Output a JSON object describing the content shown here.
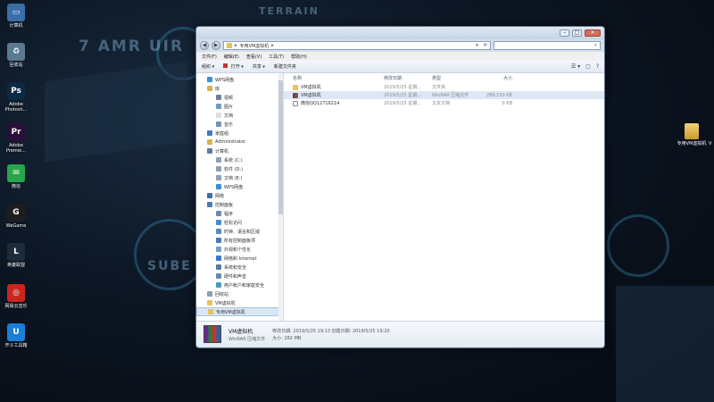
{
  "desktop": {
    "icons": [
      {
        "label": "计算机",
        "icon": "computer-icon",
        "color": "#3a6ea8",
        "glyph": "▭"
      },
      {
        "label": "回收站",
        "icon": "recycle-bin-icon",
        "color": "#5a7a90",
        "glyph": "♻"
      },
      {
        "label": "Adobe Photosh...",
        "icon": "photoshop-icon",
        "color": "#0b2a44",
        "glyph": "Ps"
      },
      {
        "label": "Adobe Premie...",
        "icon": "premiere-icon",
        "color": "#2a0f3a",
        "glyph": "Pr"
      },
      {
        "label": "微信",
        "icon": "wechat-icon",
        "color": "#2aa44a",
        "glyph": "✉"
      },
      {
        "label": "WeGame",
        "icon": "wegame-icon",
        "color": "#1e1e1e",
        "glyph": "G"
      },
      {
        "label": "英雄联盟",
        "icon": "lol-icon",
        "color": "#1d2c3a",
        "glyph": "L"
      },
      {
        "label": "网易云音乐",
        "icon": "netease-music-icon",
        "color": "#c8261e",
        "glyph": "◎"
      },
      {
        "label": "开斗工具箱",
        "icon": "toolbox-icon",
        "color": "#1b7fd6",
        "glyph": "U"
      }
    ],
    "right_icon": {
      "label": "专用VM虚拟机",
      "icon": "folder-icon"
    },
    "right_icon_extra": "V"
  },
  "window": {
    "address": {
      "path_sep": "▸",
      "path": "专用VM虚拟机",
      "arrow": "▸",
      "dropdown": "▾",
      "refresh": "⟳",
      "search_icon": "⌕"
    },
    "title_buttons": {
      "minimize": "–",
      "maximize": "□",
      "close": "✕"
    },
    "nav_back": "◀",
    "nav_forward": "▶",
    "menu": [
      "文件(F)",
      "编辑(E)",
      "查看(V)",
      "工具(T)",
      "帮助(H)"
    ],
    "toolbar": {
      "organize": "组织 ▾",
      "open": "打开 ▾",
      "share": "共享 ▾",
      "new_folder": "新建文件夹",
      "icons": [
        "☰ ▾",
        "▢",
        "?"
      ]
    },
    "nav_pane": [
      {
        "label": "WPS网盘",
        "indent": 1,
        "color": "#3a8fd8"
      },
      {
        "label": "库",
        "indent": 1,
        "color": "#d9b24a"
      },
      {
        "label": "视频",
        "indent": 2,
        "color": "#6a7fa0"
      },
      {
        "label": "图片",
        "indent": 2,
        "color": "#6a9fc0"
      },
      {
        "label": "文档",
        "indent": 2,
        "color": "#e0e0e0"
      },
      {
        "label": "音乐",
        "indent": 2,
        "color": "#7a90c0"
      },
      {
        "label": "家庭组",
        "indent": 1,
        "color": "#3a7ac8"
      },
      {
        "label": "Administrator",
        "indent": 1,
        "color": "#d9b24a"
      },
      {
        "label": "计算机",
        "indent": 1,
        "color": "#5a7a9a"
      },
      {
        "label": "系统 (C:)",
        "indent": 2,
        "color": "#8aa0b8"
      },
      {
        "label": "软件 (D:)",
        "indent": 2,
        "color": "#8aa0b8"
      },
      {
        "label": "文档 (E:)",
        "indent": 2,
        "color": "#8aa0b8"
      },
      {
        "label": "WPS网盘",
        "indent": 2,
        "color": "#3a8fd8"
      },
      {
        "label": "网络",
        "indent": 1,
        "color": "#3a6ea8"
      },
      {
        "label": "控制面板",
        "indent": 1,
        "color": "#4a7ab8"
      },
      {
        "label": "程序",
        "indent": 2,
        "color": "#6a8ab0"
      },
      {
        "label": "轻松访问",
        "indent": 2,
        "color": "#3a8fd8"
      },
      {
        "label": "时钟、语言和区域",
        "indent": 2,
        "color": "#5a8ac0"
      },
      {
        "label": "所有控制面板项",
        "indent": 2,
        "color": "#4a7ab8"
      },
      {
        "label": "外观和个性化",
        "indent": 2,
        "color": "#7a9ac8"
      },
      {
        "label": "网络和 Internet",
        "indent": 2,
        "color": "#3a7ac8"
      },
      {
        "label": "系统和安全",
        "indent": 2,
        "color": "#5a7aa0"
      },
      {
        "label": "硬件和声音",
        "indent": 2,
        "color": "#6a8aa8"
      },
      {
        "label": "用户帐户和家庭安全",
        "indent": 2,
        "color": "#4a9ac0"
      },
      {
        "label": "回收站",
        "indent": 1,
        "color": "#8aa0b0"
      },
      {
        "label": "VM虚拟机",
        "indent": 1,
        "color": "#e9c25a"
      },
      {
        "label": "专用VM虚拟机",
        "indent": 1,
        "color": "#e9c25a",
        "selected": true
      }
    ],
    "columns": {
      "name": "名称",
      "date": "修改日期",
      "type": "类型",
      "size": "大小"
    },
    "files": [
      {
        "name": "VM虚拟机",
        "date": "2019/5/25 星期...",
        "type": "文件夹",
        "size": "",
        "kind": "folder-c"
      },
      {
        "name": "VM虚拟机",
        "date": "2019/5/25 星期...",
        "type": "WinRAR 压缩文件",
        "size": "289,150 KB",
        "kind": "rar-c",
        "selected": true
      },
      {
        "name": "微信QQ12716214",
        "date": "2019/5/25 星期...",
        "type": "文本文档",
        "size": "0 KB",
        "kind": "txt-c"
      }
    ],
    "details": {
      "name": "VM虚拟机",
      "type": "WinRAR 压缩文件",
      "modified": "修改日期: 2019/5/25 19:13",
      "created": "创建日期: 2019/5/25 19:20",
      "size": "大小: 282 MB"
    }
  }
}
